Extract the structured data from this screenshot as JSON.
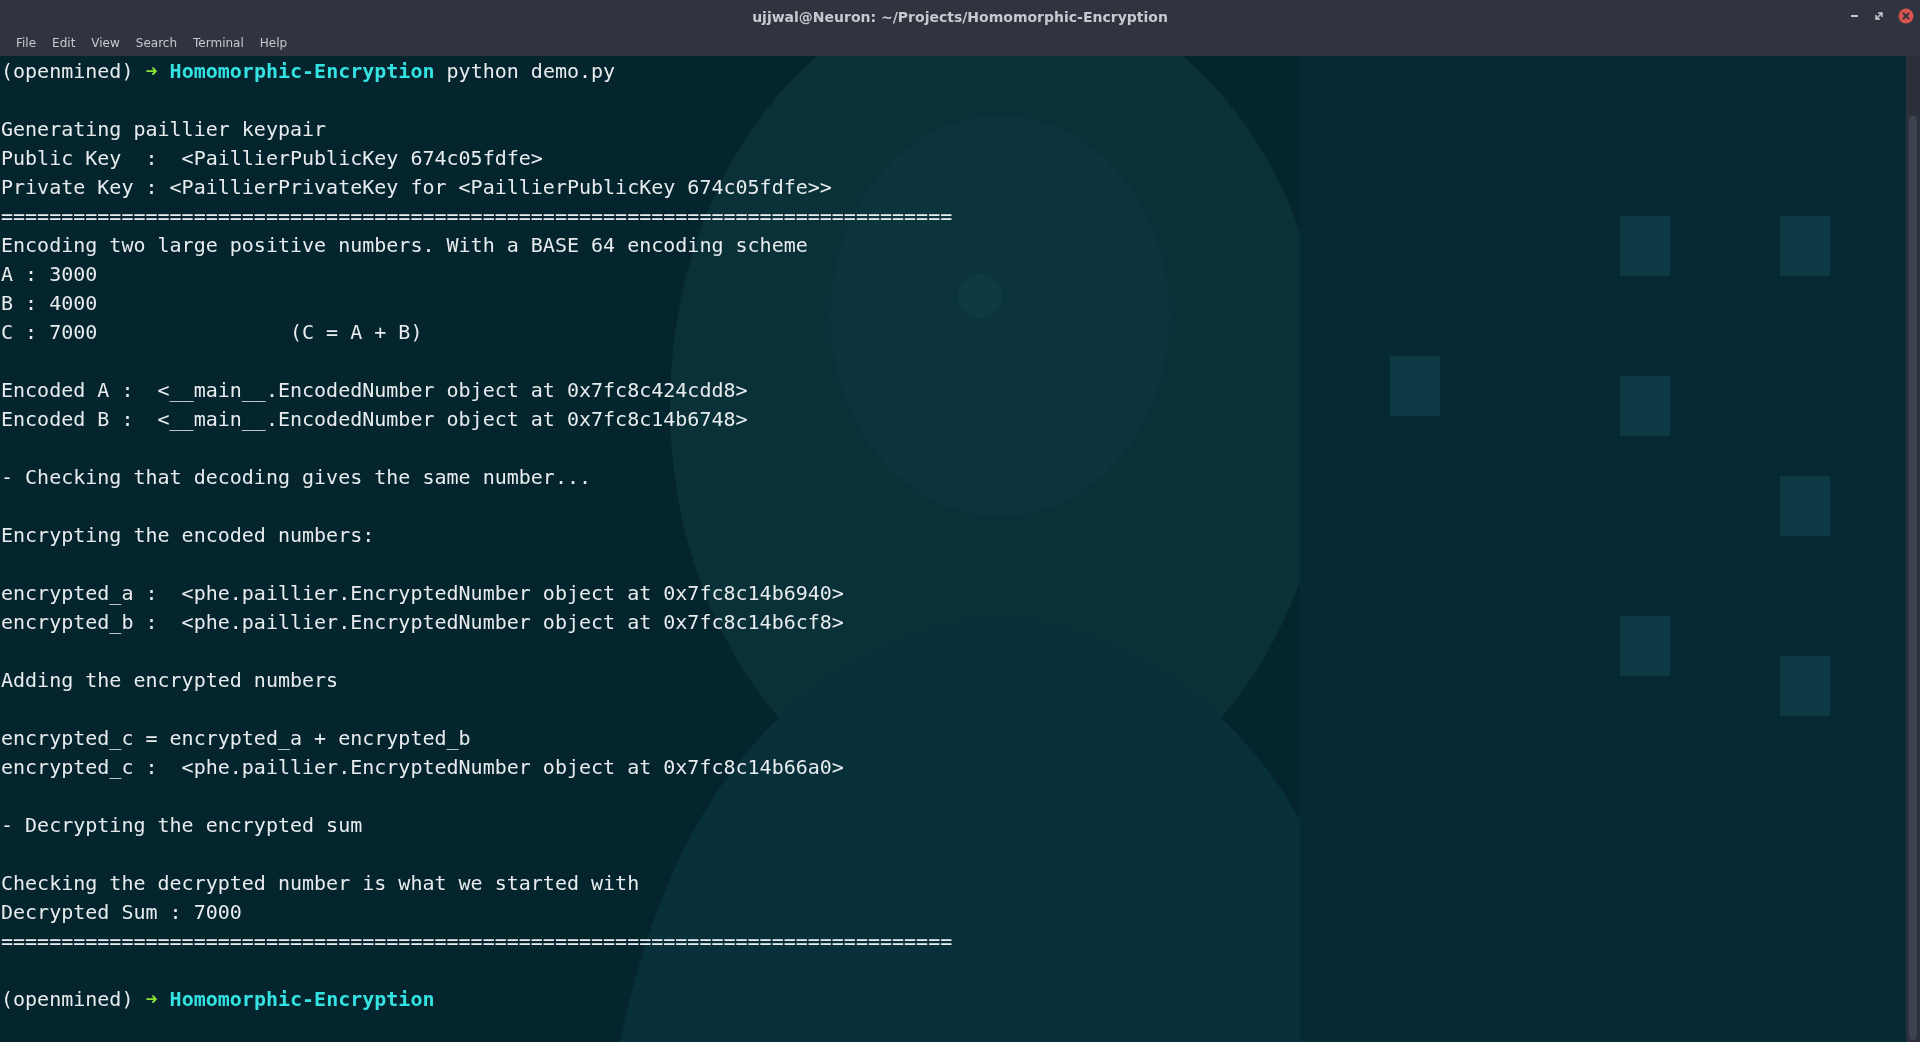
{
  "window": {
    "title": "ujjwal@Neuron: ~/Projects/Homomorphic-Encryption"
  },
  "menu": [
    "File",
    "Edit",
    "View",
    "Search",
    "Terminal",
    "Help"
  ],
  "lines": [
    {
      "kind": "prompt",
      "env": "(openmined)",
      "arrow": "➜",
      "dir": "Homomorphic-Encryption",
      "command": "python demo.py"
    },
    {
      "kind": "blank"
    },
    {
      "kind": "text",
      "text": "Generating paillier keypair"
    },
    {
      "kind": "text",
      "text": "Public Key  :  <PaillierPublicKey 674c05fdfe>"
    },
    {
      "kind": "text",
      "text": "Private Key : <PaillierPrivateKey for <PaillierPublicKey 674c05fdfe>>"
    },
    {
      "kind": "text",
      "text": "==============================================================================="
    },
    {
      "kind": "text",
      "text": "Encoding two large positive numbers. With a BASE 64 encoding scheme"
    },
    {
      "kind": "text",
      "text": "A : 3000"
    },
    {
      "kind": "text",
      "text": "B : 4000"
    },
    {
      "kind": "text",
      "text": "C : 7000                (C = A + B)"
    },
    {
      "kind": "blank"
    },
    {
      "kind": "text",
      "text": "Encoded A :  <__main__.EncodedNumber object at 0x7fc8c424cdd8>"
    },
    {
      "kind": "text",
      "text": "Encoded B :  <__main__.EncodedNumber object at 0x7fc8c14b6748>"
    },
    {
      "kind": "blank"
    },
    {
      "kind": "text",
      "text": "- Checking that decoding gives the same number..."
    },
    {
      "kind": "blank"
    },
    {
      "kind": "text",
      "text": "Encrypting the encoded numbers:"
    },
    {
      "kind": "blank"
    },
    {
      "kind": "text",
      "text": "encrypted_a :  <phe.paillier.EncryptedNumber object at 0x7fc8c14b6940>"
    },
    {
      "kind": "text",
      "text": "encrypted_b :  <phe.paillier.EncryptedNumber object at 0x7fc8c14b6cf8>"
    },
    {
      "kind": "blank"
    },
    {
      "kind": "text",
      "text": "Adding the encrypted numbers"
    },
    {
      "kind": "blank"
    },
    {
      "kind": "text",
      "text": "encrypted_c = encrypted_a + encrypted_b"
    },
    {
      "kind": "text",
      "text": "encrypted_c :  <phe.paillier.EncryptedNumber object at 0x7fc8c14b66a0>"
    },
    {
      "kind": "blank"
    },
    {
      "kind": "text",
      "text": "- Decrypting the encrypted sum"
    },
    {
      "kind": "blank"
    },
    {
      "kind": "text",
      "text": "Checking the decrypted number is what we started with"
    },
    {
      "kind": "text",
      "text": "Decrypted Sum : 7000"
    },
    {
      "kind": "text",
      "text": "==============================================================================="
    },
    {
      "kind": "blank"
    },
    {
      "kind": "prompt",
      "env": "(openmined)",
      "arrow": "➜",
      "dir": "Homomorphic-Encryption"
    }
  ]
}
